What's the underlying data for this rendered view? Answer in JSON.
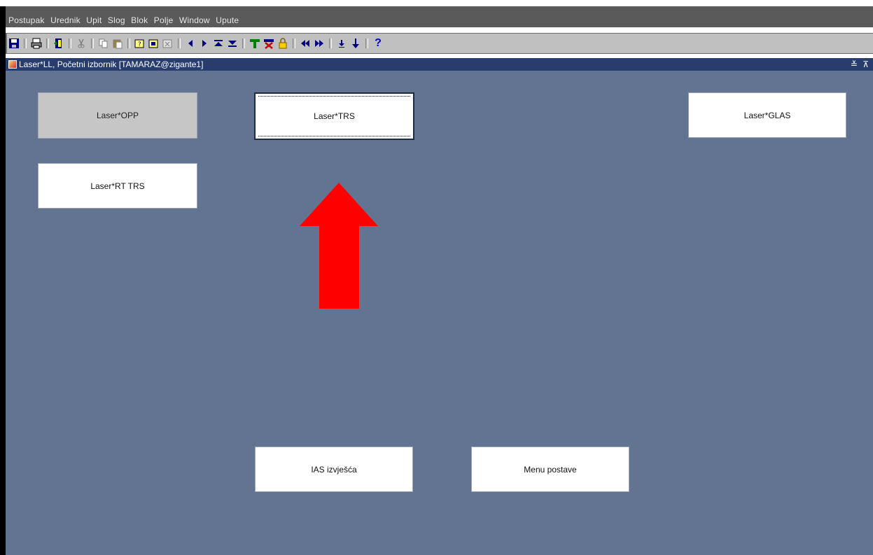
{
  "menubar": {
    "items": [
      "Postupak",
      "Urednik",
      "Upit",
      "Slog",
      "Blok",
      "Polje",
      "Window",
      "Upute"
    ]
  },
  "toolbar": {
    "icons": [
      "save-icon",
      "print-icon",
      "exit-door-icon",
      "cut-icon",
      "copy-icon",
      "paste-icon",
      "query-enter-icon",
      "query-execute-icon",
      "query-cancel-icon",
      "previous-record-icon",
      "next-record-icon",
      "first-block-icon",
      "last-block-icon",
      "insert-record-icon",
      "delete-record-icon",
      "lock-record-icon",
      "previous-block-icon",
      "next-block-icon",
      "down-small-icon",
      "down-arrow-icon",
      "help-icon"
    ],
    "help_glyph": "?"
  },
  "window": {
    "title": "Laser*LL,  Početni izbornik  [TAMARAZ@zigante1]",
    "controls": "≚ ⊼"
  },
  "buttons": {
    "opp": "Laser*OPP",
    "trs": "Laser*TRS",
    "glas": "Laser*GLAS",
    "rt_trs": "Laser*RT TRS",
    "ias": "IAS izvješća",
    "menu_postave": "Menu postave"
  },
  "colors": {
    "menubar_bg": "#5a5a5a",
    "titlebar_bg": "#283c6e",
    "content_bg": "#627491",
    "arrow": "#ff0000"
  }
}
